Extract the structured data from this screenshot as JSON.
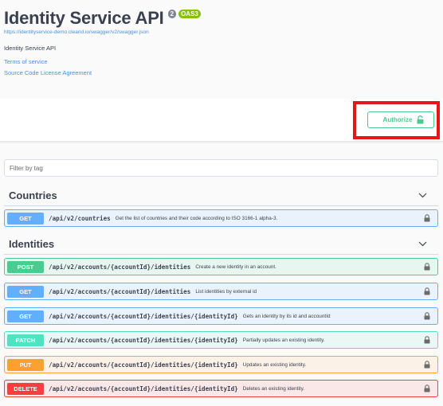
{
  "info": {
    "title": "Identity Service API",
    "version_badge": "2",
    "oas_badge": "OAS3",
    "url": "https://identityservice-demo.clearid.io/swagger/v2/swagger.json",
    "description": "Identity Service API",
    "terms_link": "Terms of service",
    "license_link": "Source Code License Agreement"
  },
  "authorize": {
    "label": "Authorize",
    "icon": "unlock-icon",
    "highlight_color": "#e4161c"
  },
  "filter": {
    "placeholder": "Filter by tag",
    "value": ""
  },
  "tags": [
    {
      "name": "Countries",
      "operations": [
        {
          "method": "GET",
          "path": "/api/v2/countries",
          "summary": "Get the list of countries and their code according to ISO 3166-1 alpha-3."
        }
      ]
    },
    {
      "name": "Identities",
      "operations": [
        {
          "method": "POST",
          "path": "/api/v2/accounts/{accountId}/identities",
          "summary": "Create a new identity in an account."
        },
        {
          "method": "GET",
          "path": "/api/v2/accounts/{accountId}/identities",
          "summary": "List identities by external id"
        },
        {
          "method": "GET",
          "path": "/api/v2/accounts/{accountId}/identities/{identityId}",
          "summary": "Gets an identity by its id and accountId"
        },
        {
          "method": "PATCH",
          "path": "/api/v2/accounts/{accountId}/identities/{identityId}",
          "summary": "Partially updates an existing identity."
        },
        {
          "method": "PUT",
          "path": "/api/v2/accounts/{accountId}/identities/{identityId}",
          "summary": "Updates an existing identity."
        },
        {
          "method": "DELETE",
          "path": "/api/v2/accounts/{accountId}/identities/{identityId}",
          "summary": "Deletes an existing identity."
        }
      ]
    }
  ],
  "colors": {
    "get": "#61affe",
    "post": "#49cc90",
    "patch": "#50e3c2",
    "put": "#fca130",
    "delete": "#f93e3e"
  }
}
